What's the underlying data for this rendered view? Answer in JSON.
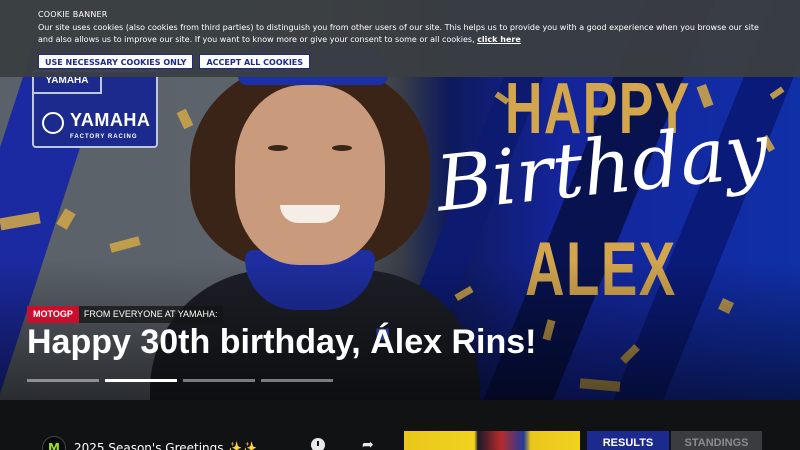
{
  "cookie_banner": {
    "title": "COOKIE BANNER",
    "text": "Our site uses cookies (also cookies from third parties) to distinguish you from other users of our site. This helps us to provide you with a good experience when you browse our site and also allows us to improve our site. If you want to know more or give your consent to some or all cookies,",
    "link_label": "click here",
    "necessary_button": "USE NECESSARY COOKIES ONLY",
    "accept_button": "ACCEPT ALL COOKIES"
  },
  "hero": {
    "badge_top": "YAMAHA",
    "badge_brand": "YAMAHA",
    "badge_sub": "FACTORY RACING",
    "graphic_happy": "HAPPY",
    "graphic_birthday": "Birthday",
    "graphic_name": "ALEX",
    "category_tag": "MOTOGP",
    "subtitle": "FROM EVERYONE AT YAMAHA:",
    "headline": "Happy 30th birthday, Álex Rins!",
    "active_slide": 2,
    "slide_count": 4
  },
  "bottom": {
    "news_title": "2025 Season's Greetings ✨✨",
    "news_avatar_icon": "monster-energy-icon",
    "clock_icon": "clock-icon",
    "share_icon": "share-icon",
    "tabs": [
      "RESULTS",
      "STANDINGS"
    ],
    "active_tab": "RESULTS"
  },
  "colors": {
    "brand_blue": "#1b2a8c",
    "accent_gold": "#d3a64e",
    "motogp_red": "#c8102e"
  }
}
